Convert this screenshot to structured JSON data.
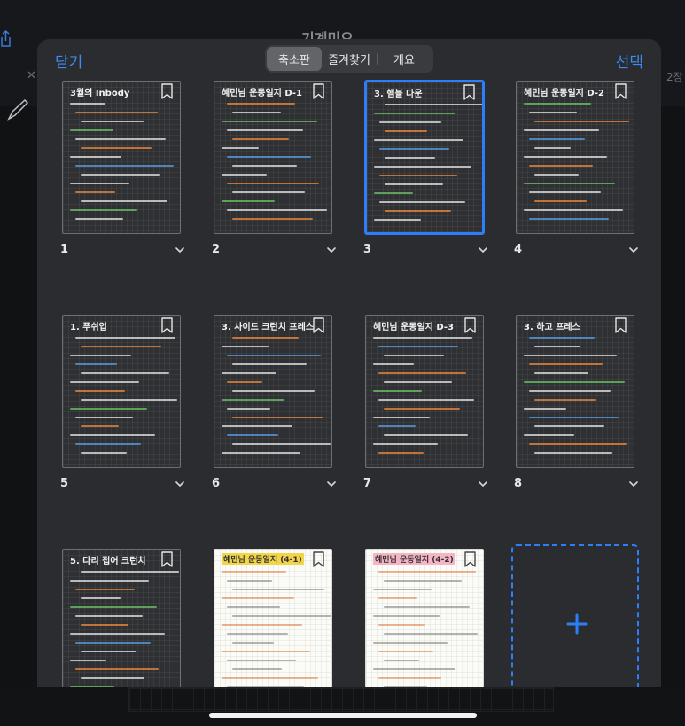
{
  "background": {
    "title": "기계미오",
    "right_text": "2장"
  },
  "sheet": {
    "close_label": "닫기",
    "select_label": "선택",
    "segments": [
      {
        "label": "축소판",
        "active": true
      },
      {
        "label": "즐겨찾기",
        "active": false
      },
      {
        "label": "개요",
        "active": false
      }
    ]
  },
  "pages": [
    {
      "number": "1",
      "title": "3월의 Inbody",
      "theme": "dark",
      "selected": false,
      "highlight": ""
    },
    {
      "number": "2",
      "title": "혜민님 운동일지 D-1",
      "theme": "dark",
      "selected": false,
      "highlight": ""
    },
    {
      "number": "3",
      "title": "3. 햄블 다운",
      "theme": "dark",
      "selected": true,
      "highlight": ""
    },
    {
      "number": "4",
      "title": "혜민님 운동일지 D-2",
      "theme": "dark",
      "selected": false,
      "highlight": ""
    },
    {
      "number": "5",
      "title": "1. 푸쉬업",
      "theme": "dark",
      "selected": false,
      "highlight": ""
    },
    {
      "number": "6",
      "title": "3. 사이드 크런치 프레스",
      "theme": "dark",
      "selected": false,
      "highlight": ""
    },
    {
      "number": "7",
      "title": "혜민님 운동일지 D-3",
      "theme": "dark",
      "selected": false,
      "highlight": ""
    },
    {
      "number": "8",
      "title": "3. 하고 프레스",
      "theme": "dark",
      "selected": false,
      "highlight": ""
    },
    {
      "number": "",
      "title": "5. 다리 접어 크런치",
      "theme": "dark",
      "selected": false,
      "highlight": ""
    },
    {
      "number": "",
      "title": "혜민님 운동일지 (4-1)",
      "theme": "light",
      "selected": false,
      "highlight": "yellow"
    },
    {
      "number": "",
      "title": "혜민님 운동일지 (4-2)",
      "theme": "light",
      "selected": false,
      "highlight": "pink"
    }
  ],
  "colors": {
    "accent": "#2d7ff9",
    "sheet": "#2b2c2f"
  },
  "icons": {
    "bookmark": "bookmark-icon",
    "chevron": "chevron-down-icon",
    "add": "plus-icon"
  }
}
